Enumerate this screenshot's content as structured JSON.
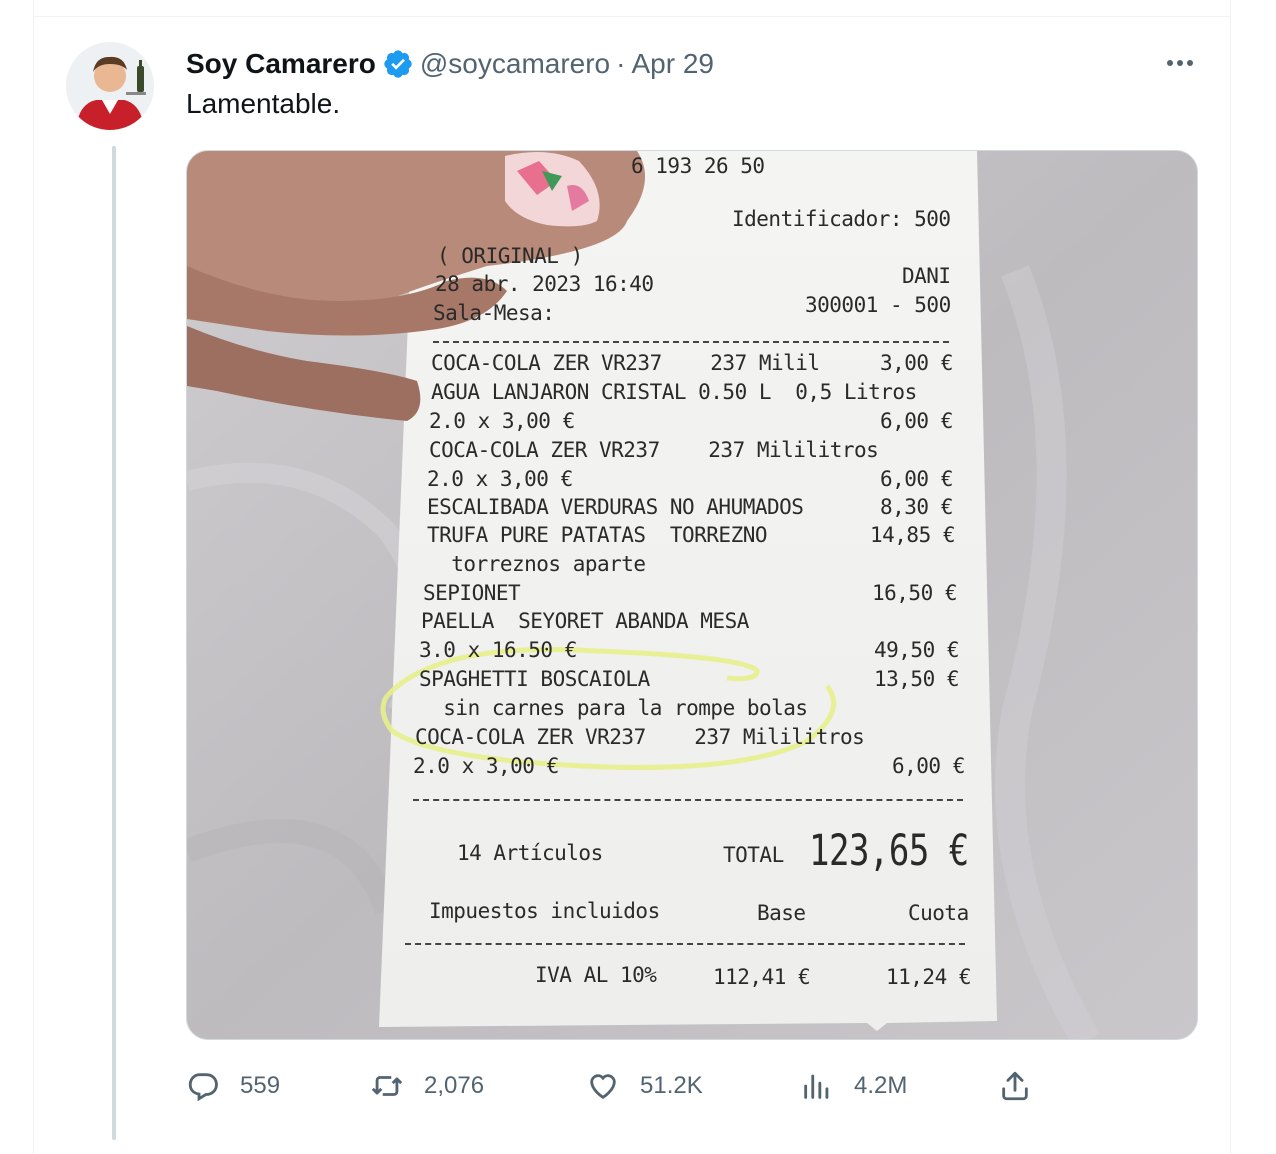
{
  "tweet": {
    "author_name": "Soy Camarero",
    "handle": "@soycamarero",
    "separator": "·",
    "date": "Apr 29",
    "text": "Lamentable."
  },
  "receipt": {
    "phone": "6 193 26 50",
    "identifier": "Identificador: 500",
    "original": "( ORIGINAL )",
    "datetime": "28 abr. 2023 16:40",
    "waiter": "DANI",
    "sala_label": "Sala-Mesa:",
    "sala_value": "300001 - 500",
    "lines": [
      {
        "text": "COCA-COLA ZER VR237    237 Milil",
        "price": "3,00 €"
      },
      {
        "text": "AGUA LANJARON CRISTAL 0.50 L  0,5 Litros",
        "price": ""
      },
      {
        "text": "2.0 x 3,00 €",
        "price": "6,00 €"
      },
      {
        "text": "COCA-COLA ZER VR237    237 Mililitros",
        "price": ""
      },
      {
        "text": "2.0 x 3,00 €",
        "price": "6,00 €"
      },
      {
        "text": "ESCALIBADA VERDURAS NO AHUMADOS",
        "price": "8,30 €"
      },
      {
        "text": "TRUFA PURE PATATAS  TORREZNO",
        "price": "14,85 €"
      },
      {
        "text": "  torreznos aparte",
        "price": ""
      },
      {
        "text": "SEPIONET",
        "price": "16,50 €"
      },
      {
        "text": "PAELLA  SEYORET ABANDA MESA",
        "price": ""
      },
      {
        "text": "3.0 x 16.50 €",
        "price": "49,50 €"
      },
      {
        "text": "SPAGHETTI BOSCAIOLA",
        "price": "13,50 €"
      },
      {
        "text": "  sin carnes para la rompe bolas",
        "price": ""
      },
      {
        "text": "COCA-COLA ZER VR237    237 Mililitros",
        "price": ""
      },
      {
        "text": "2.0 x 3,00 €",
        "price": "6,00 €"
      }
    ],
    "articles": "14 Artículos",
    "total_label": "TOTAL",
    "total_value": "123,65 €",
    "taxes_label": "Impuestos incluidos",
    "base_label": "Base",
    "cuota_label": "Cuota",
    "iva_label": "IVA AL 10%",
    "iva_base": "112,41 €",
    "iva_cuota": "11,24 €"
  },
  "actions": {
    "replies": "559",
    "retweets": "2,076",
    "likes": "51.2K",
    "views": "4.2M"
  },
  "colors": {
    "text_primary": "#0f1419",
    "text_secondary": "#536471",
    "verified_blue": "#1d9bf0",
    "divider": "#eff3f4",
    "highlight_circle": "#e6f08a"
  },
  "icons": [
    "verified-badge-icon",
    "more-icon",
    "reply-icon",
    "retweet-icon",
    "like-icon",
    "views-icon",
    "share-icon"
  ]
}
